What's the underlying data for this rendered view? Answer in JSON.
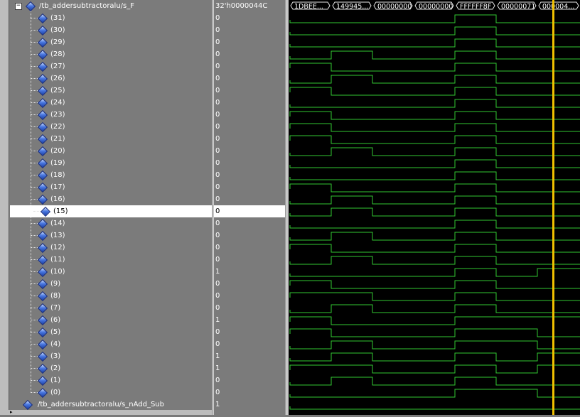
{
  "signals": [
    {
      "name": "/tb_addersubtractoralu/s_F",
      "value": "32'h0000044C",
      "level": 0,
      "expanded": true,
      "expander": "−"
    },
    {
      "name": "(31)",
      "value": "0",
      "level": 1
    },
    {
      "name": "(30)",
      "value": "0",
      "level": 1
    },
    {
      "name": "(29)",
      "value": "0",
      "level": 1
    },
    {
      "name": "(28)",
      "value": "0",
      "level": 1
    },
    {
      "name": "(27)",
      "value": "0",
      "level": 1
    },
    {
      "name": "(26)",
      "value": "0",
      "level": 1
    },
    {
      "name": "(25)",
      "value": "0",
      "level": 1
    },
    {
      "name": "(24)",
      "value": "0",
      "level": 1
    },
    {
      "name": "(23)",
      "value": "0",
      "level": 1
    },
    {
      "name": "(22)",
      "value": "0",
      "level": 1
    },
    {
      "name": "(21)",
      "value": "0",
      "level": 1
    },
    {
      "name": "(20)",
      "value": "0",
      "level": 1
    },
    {
      "name": "(19)",
      "value": "0",
      "level": 1
    },
    {
      "name": "(18)",
      "value": "0",
      "level": 1
    },
    {
      "name": "(17)",
      "value": "0",
      "level": 1
    },
    {
      "name": "(16)",
      "value": "0",
      "level": 1
    },
    {
      "name": "(15)",
      "value": "0",
      "level": 1,
      "selected": true
    },
    {
      "name": "(14)",
      "value": "0",
      "level": 1
    },
    {
      "name": "(13)",
      "value": "0",
      "level": 1
    },
    {
      "name": "(12)",
      "value": "0",
      "level": 1
    },
    {
      "name": "(11)",
      "value": "0",
      "level": 1
    },
    {
      "name": "(10)",
      "value": "1",
      "level": 1
    },
    {
      "name": "(9)",
      "value": "0",
      "level": 1
    },
    {
      "name": "(8)",
      "value": "0",
      "level": 1
    },
    {
      "name": "(7)",
      "value": "0",
      "level": 1
    },
    {
      "name": "(6)",
      "value": "1",
      "level": 1
    },
    {
      "name": "(5)",
      "value": "0",
      "level": 1
    },
    {
      "name": "(4)",
      "value": "0",
      "level": 1
    },
    {
      "name": "(3)",
      "value": "1",
      "level": 1
    },
    {
      "name": "(2)",
      "value": "1",
      "level": 1
    },
    {
      "name": "(1)",
      "value": "0",
      "level": 1
    },
    {
      "name": "(0)",
      "value": "0",
      "level": 1
    },
    {
      "name": "/tb_addersubtractoralu/s_nAdd_Sub",
      "value": "1",
      "level": 0
    }
  ],
  "bus_segments": [
    "1DBEE...",
    "149945...",
    "00000000",
    "00000000",
    "FFFFFF8F",
    "00000071",
    "000004..."
  ],
  "bit_waves": [
    [
      0,
      0,
      0,
      0,
      1,
      0,
      0
    ],
    [
      0,
      0,
      0,
      0,
      1,
      0,
      0
    ],
    [
      0,
      0,
      0,
      0,
      1,
      0,
      0
    ],
    [
      0,
      1,
      0,
      0,
      1,
      0,
      0
    ],
    [
      1,
      0,
      0,
      0,
      1,
      0,
      0
    ],
    [
      0,
      1,
      0,
      0,
      1,
      0,
      0
    ],
    [
      1,
      0,
      0,
      0,
      1,
      0,
      0
    ],
    [
      0,
      0,
      0,
      0,
      1,
      0,
      0
    ],
    [
      1,
      0,
      0,
      0,
      1,
      0,
      0
    ],
    [
      1,
      0,
      0,
      0,
      1,
      0,
      0
    ],
    [
      1,
      0,
      0,
      0,
      1,
      0,
      0
    ],
    [
      0,
      1,
      0,
      0,
      1,
      0,
      0
    ],
    [
      0,
      0,
      0,
      0,
      1,
      0,
      0
    ],
    [
      0,
      0,
      0,
      0,
      1,
      0,
      0
    ],
    [
      1,
      0,
      0,
      0,
      1,
      0,
      0
    ],
    [
      0,
      1,
      0,
      0,
      1,
      0,
      0
    ],
    [
      0,
      1,
      0,
      0,
      1,
      0,
      0
    ],
    [
      0,
      0,
      0,
      0,
      1,
      0,
      0
    ],
    [
      0,
      1,
      0,
      0,
      1,
      0,
      0
    ],
    [
      1,
      0,
      0,
      0,
      1,
      0,
      0
    ],
    [
      0,
      1,
      0,
      0,
      1,
      0,
      0
    ],
    [
      0,
      0,
      0,
      0,
      1,
      0,
      1
    ],
    [
      1,
      0,
      0,
      0,
      1,
      0,
      0
    ],
    [
      1,
      1,
      0,
      0,
      1,
      0,
      0
    ],
    [
      0,
      1,
      0,
      0,
      1,
      0,
      0
    ],
    [
      1,
      0,
      0,
      0,
      1,
      1,
      1
    ],
    [
      1,
      0,
      0,
      0,
      1,
      1,
      0
    ],
    [
      0,
      1,
      0,
      0,
      1,
      1,
      0
    ],
    [
      0,
      1,
      0,
      0,
      1,
      0,
      1
    ],
    [
      1,
      1,
      0,
      0,
      1,
      0,
      1
    ],
    [
      0,
      1,
      0,
      0,
      1,
      0,
      0
    ],
    [
      0,
      0,
      0,
      0,
      1,
      1,
      0
    ]
  ],
  "control_wave": [
    0,
    0,
    0,
    0,
    0,
    0,
    0
  ],
  "colors": {
    "wave": "#32c832",
    "cursor": "#f0c000",
    "bus_outline": "#e6e6e6",
    "panel": "#7b7b7b",
    "selected_row": "#ffffff"
  },
  "icons": {
    "signal": "blue-diamond-icon",
    "expander": "tree-collapse-icon"
  }
}
